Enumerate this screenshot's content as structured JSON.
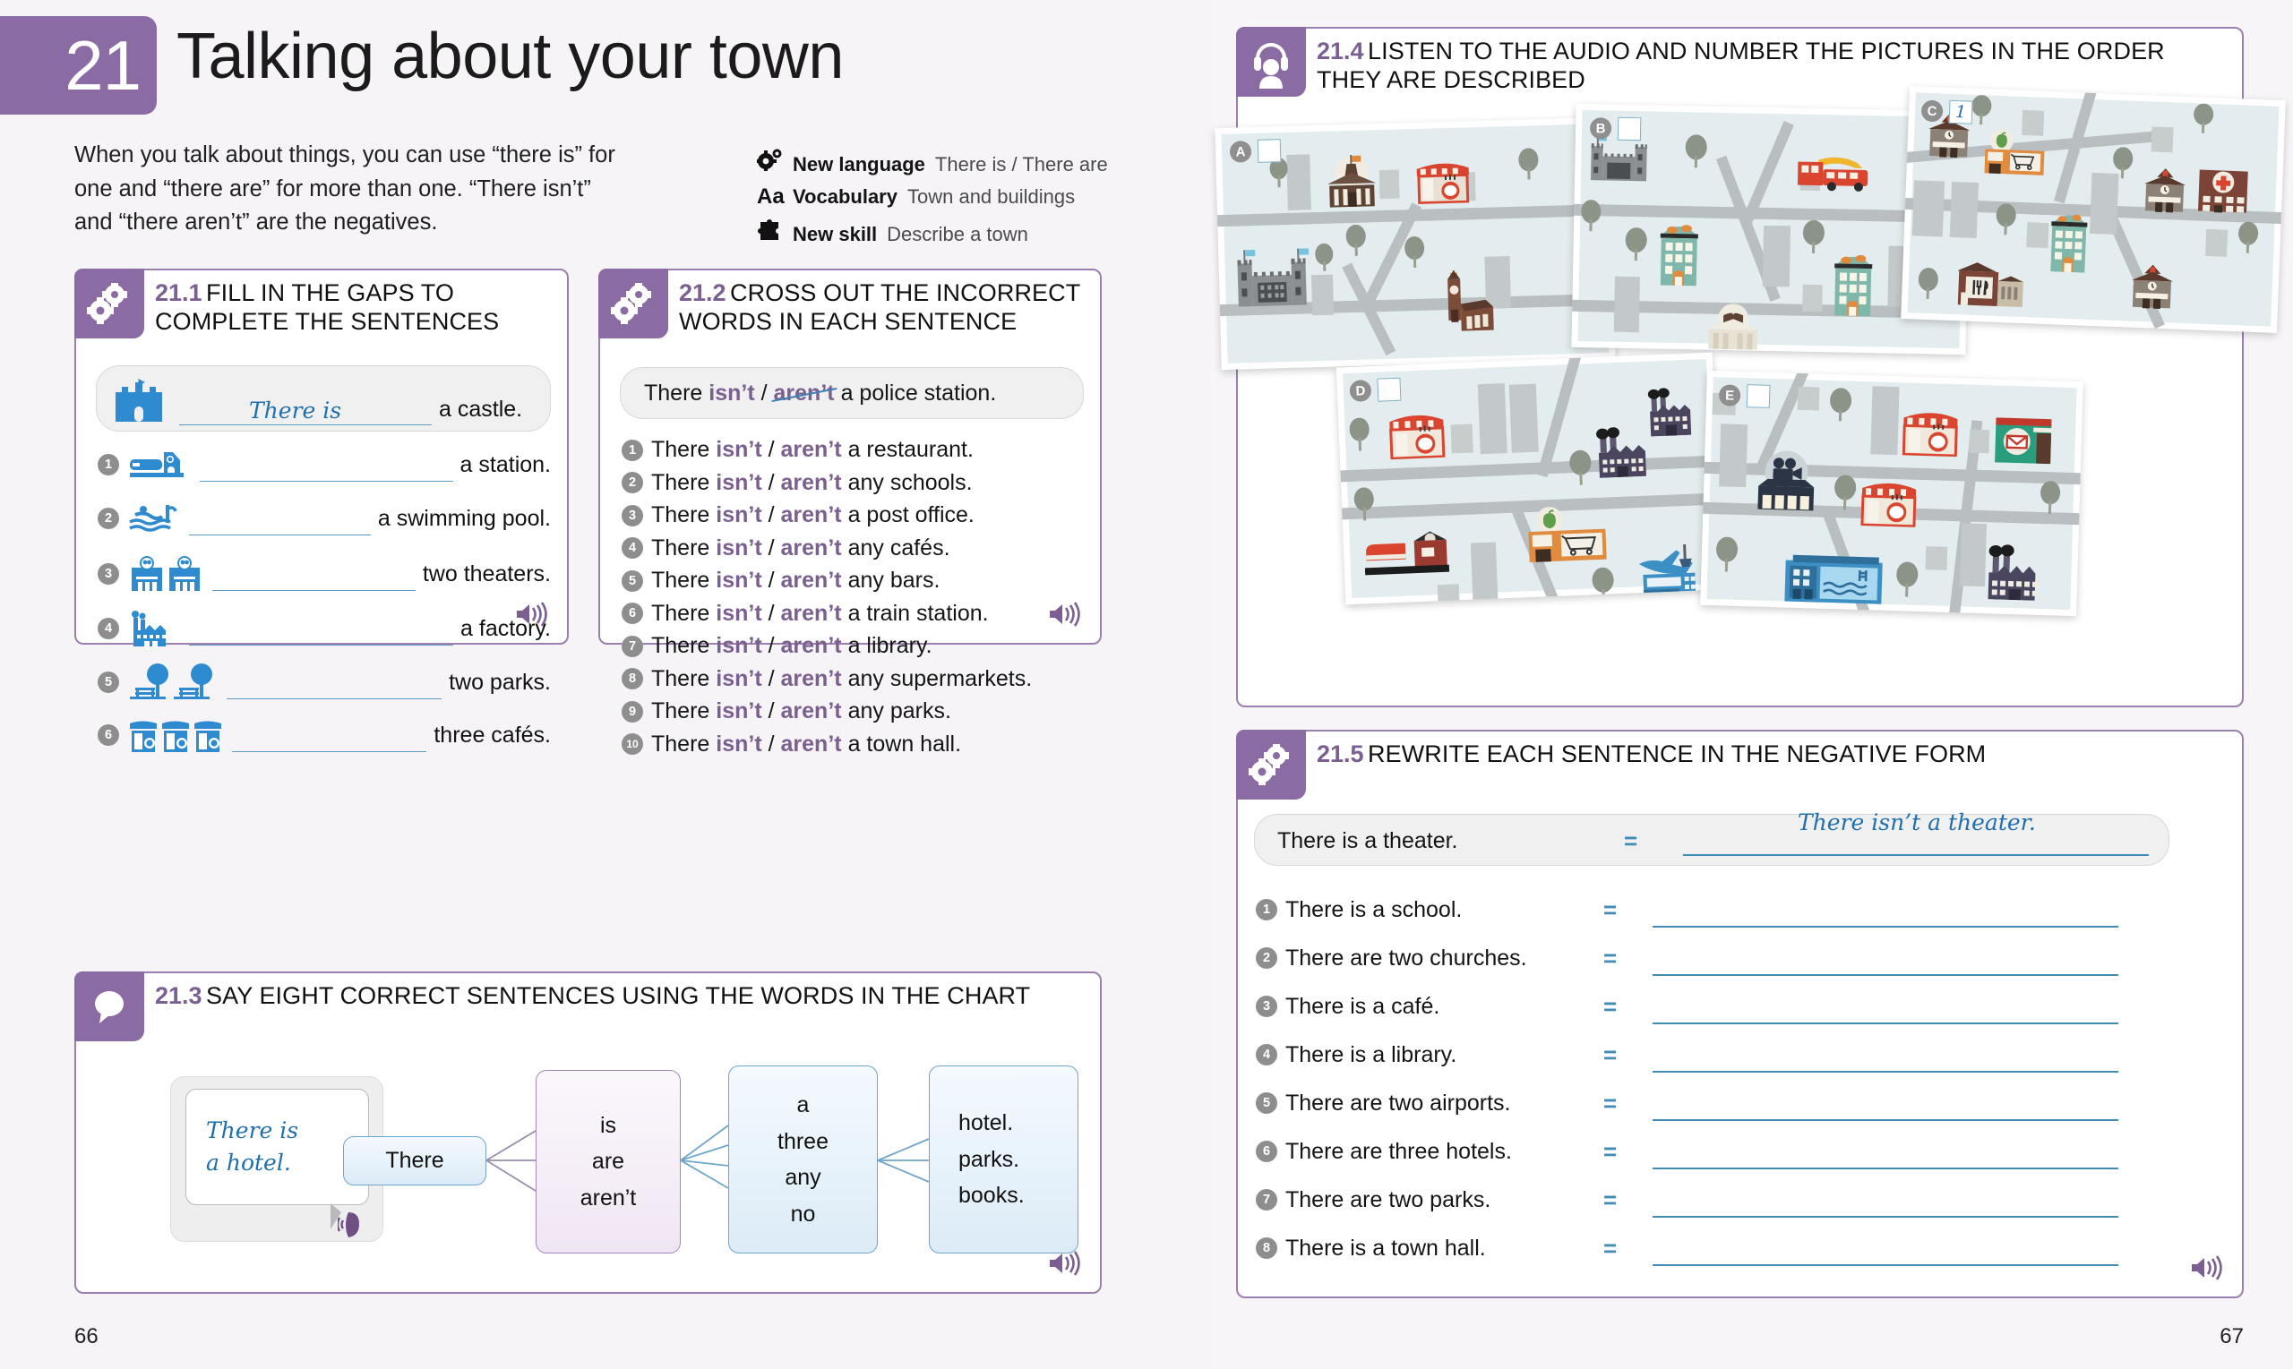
{
  "chapter": {
    "number": "21",
    "title": "Talking about your town"
  },
  "intro": "When you talk about things, you can use “there is” for one and “there are” for more than one. “There isn’t” and “there aren’t” are the negatives.",
  "meta": [
    {
      "icon": "gears-icon",
      "label": "New language",
      "value": "There is / There are"
    },
    {
      "icon": "aa-icon",
      "label": "Vocabulary",
      "value": "Town and buildings"
    },
    {
      "icon": "puzzle-icon",
      "label": "New skill",
      "value": "Describe a town"
    }
  ],
  "ex211": {
    "number": "21.1",
    "title": "FILL IN THE GAPS TO COMPLETE THE SENTENCES",
    "example": {
      "icon": "castle-icon",
      "answer": "There is",
      "tail": "a castle."
    },
    "items": [
      {
        "n": "1",
        "icon": "station-icon",
        "tail": "a station."
      },
      {
        "n": "2",
        "icon": "pool-icon",
        "tail": "a swimming pool."
      },
      {
        "n": "3",
        "icon": "theaters-icon",
        "tail": "two theaters."
      },
      {
        "n": "4",
        "icon": "factory-icon",
        "tail": "a factory."
      },
      {
        "n": "5",
        "icon": "parks-icon",
        "tail": "two parks."
      },
      {
        "n": "6",
        "icon": "cafes-icon",
        "tail": "three cafés."
      }
    ],
    "audio": "speaker-icon"
  },
  "ex212": {
    "number": "21.2",
    "title": "CROSS OUT THE INCORRECT WORDS IN EACH SENTENCE",
    "example": {
      "pre": "There",
      "opt1": "isn’t",
      "sep": "/",
      "opt2": "aren’t",
      "post": "a police station.",
      "crossed": "opt2"
    },
    "items": [
      {
        "n": "1",
        "pre": "There",
        "opt1": "isn’t",
        "opt2": "aren’t",
        "post": "a restaurant."
      },
      {
        "n": "2",
        "pre": "There",
        "opt1": "isn’t",
        "opt2": "aren’t",
        "post": "any schools."
      },
      {
        "n": "3",
        "pre": "There",
        "opt1": "isn’t",
        "opt2": "aren’t",
        "post": "a post office."
      },
      {
        "n": "4",
        "pre": "There",
        "opt1": "isn’t",
        "opt2": "aren’t",
        "post": "any cafés."
      },
      {
        "n": "5",
        "pre": "There",
        "opt1": "isn’t",
        "opt2": "aren’t",
        "post": "any bars."
      },
      {
        "n": "6",
        "pre": "There",
        "opt1": "isn’t",
        "opt2": "aren’t",
        "post": "a train station."
      },
      {
        "n": "7",
        "pre": "There",
        "opt1": "isn’t",
        "opt2": "aren’t",
        "post": "a library."
      },
      {
        "n": "8",
        "pre": "There",
        "opt1": "isn’t",
        "opt2": "aren’t",
        "post": "any supermarkets."
      },
      {
        "n": "9",
        "pre": "There",
        "opt1": "isn’t",
        "opt2": "aren’t",
        "post": "any parks."
      },
      {
        "n": "10",
        "pre": "There",
        "opt1": "isn’t",
        "opt2": "aren’t",
        "post": "a town hall."
      }
    ],
    "audio": "speaker-icon"
  },
  "ex213": {
    "number": "21.3",
    "title": "SAY EIGHT CORRECT SENTENCES USING THE WORDS IN THE CHART",
    "bubble": {
      "line1": "There is",
      "line2": "a hotel."
    },
    "columns": [
      {
        "id": "c1",
        "style": "blue",
        "words": [
          "There"
        ]
      },
      {
        "id": "c2",
        "style": "purple",
        "words": [
          "is",
          "are",
          "aren’t"
        ]
      },
      {
        "id": "c3",
        "style": "blue",
        "words": [
          "a",
          "three",
          "any",
          "no"
        ]
      },
      {
        "id": "c4",
        "style": "blue",
        "words": [
          "hotel.",
          "parks.",
          "books."
        ]
      }
    ],
    "audio": "speaker-icon"
  },
  "ex214": {
    "number": "21.4",
    "title": "LISTEN TO THE AUDIO AND NUMBER THE PICTURES IN THE ORDER THEY ARE DESCRIBED",
    "icon": "headphones-icon",
    "cards": [
      {
        "letter": "A",
        "answer": "",
        "landmarks": [
          "museum",
          "cafe",
          "castle",
          "church"
        ]
      },
      {
        "letter": "B",
        "answer": "",
        "landmarks": [
          "castle",
          "bus-station",
          "hotel",
          "hotel",
          "library"
        ]
      },
      {
        "letter": "C",
        "answer": "1",
        "landmarks": [
          "school",
          "supermarket",
          "school",
          "hospital",
          "hotel",
          "restaurant",
          "school"
        ]
      },
      {
        "letter": "D",
        "answer": "",
        "landmarks": [
          "cafe",
          "factory",
          "factory",
          "train-station",
          "supermarket",
          "airport"
        ]
      },
      {
        "letter": "E",
        "answer": "",
        "landmarks": [
          "cinema",
          "cafe",
          "cafe",
          "post-office",
          "swimming-pool",
          "factory"
        ]
      }
    ]
  },
  "ex215": {
    "number": "21.5",
    "title": "REWRITE EACH SENTENCE IN THE NEGATIVE FORM",
    "equals": "=",
    "example": {
      "prompt": "There is a theater.",
      "answer": "There isn’t a theater."
    },
    "items": [
      {
        "n": "1",
        "prompt": "There is a school.",
        "answer": ""
      },
      {
        "n": "2",
        "prompt": "There are two churches.",
        "answer": ""
      },
      {
        "n": "3",
        "prompt": "There is a café.",
        "answer": ""
      },
      {
        "n": "4",
        "prompt": "There is a library.",
        "answer": ""
      },
      {
        "n": "5",
        "prompt": "There are two airports.",
        "answer": ""
      },
      {
        "n": "6",
        "prompt": "There are three hotels.",
        "answer": ""
      },
      {
        "n": "7",
        "prompt": "There are two parks.",
        "answer": ""
      },
      {
        "n": "8",
        "prompt": "There is a town hall.",
        "answer": ""
      }
    ],
    "audio": "speaker-icon"
  },
  "pages": {
    "left": "66",
    "right": "67"
  },
  "colors": {
    "purple": "#8a6ba3",
    "border": "#9b7fae",
    "blue": "#3f8cb5",
    "icon_blue": "#2e8bd0",
    "neg": "#7b5f8e"
  }
}
